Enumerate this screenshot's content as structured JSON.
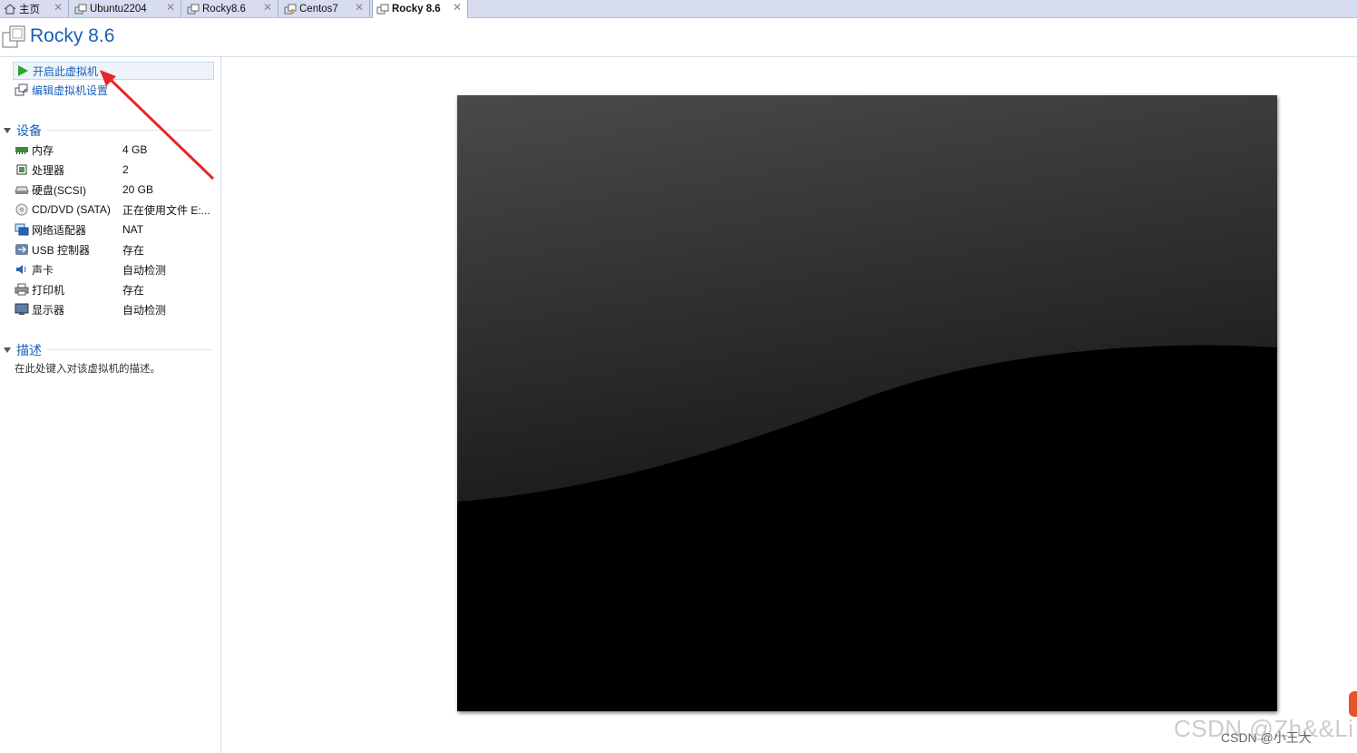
{
  "tabs": [
    {
      "label": "主页",
      "icon": "home-icon"
    },
    {
      "label": "Ubuntu2204",
      "icon": "vm-icon"
    },
    {
      "label": "Rocky8.6",
      "icon": "vm-icon"
    },
    {
      "label": "Centos7",
      "icon": "vm-icon"
    },
    {
      "label": "Rocky 8.6",
      "icon": "vm-icon",
      "active": true
    }
  ],
  "close_glyph": "✕",
  "vm_title": "Rocky 8.6",
  "commands": {
    "power_on": "开启此虚拟机",
    "edit_settings": "编辑虚拟机设置"
  },
  "devices_section": "设备",
  "devices": [
    {
      "name": "内存",
      "value": "4 GB",
      "icon": "memory-icon"
    },
    {
      "name": "处理器",
      "value": "2",
      "icon": "processor-icon"
    },
    {
      "name": "硬盘(SCSI)",
      "value": "20 GB",
      "icon": "harddisk-icon"
    },
    {
      "name": "CD/DVD (SATA)",
      "value": "正在使用文件 E:...",
      "icon": "cdrom-icon"
    },
    {
      "name": "网络适配器",
      "value": "NAT",
      "icon": "network-icon"
    },
    {
      "name": "USB 控制器",
      "value": "存在",
      "icon": "usb-icon"
    },
    {
      "name": "声卡",
      "value": "自动检测",
      "icon": "sound-icon"
    },
    {
      "name": "打印机",
      "value": "存在",
      "icon": "printer-icon"
    },
    {
      "name": "显示器",
      "value": "自动检测",
      "icon": "display-icon"
    }
  ],
  "description_section": "描述",
  "description_placeholder": "在此处键入对该虚拟机的描述。",
  "watermark": "CSDN @Zh&&Li",
  "watermark_sub": "CSDN @小王大",
  "colors": {
    "accent": "#1b5fb8",
    "tabbar": "#d8dcf0",
    "arrow": "#e8262a",
    "power_green": "#2fa52f"
  }
}
